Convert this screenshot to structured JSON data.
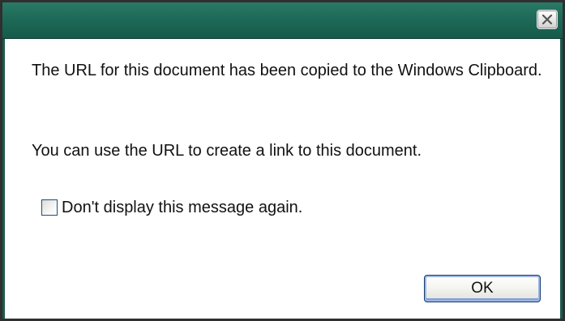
{
  "dialog": {
    "close_icon": "close-x-icon",
    "message_line": "The URL for this document has been copied to the Windows Clipboard.",
    "message_hint": "You can use the URL to create a link to this document.",
    "checkbox_label": "Don't display this message again.",
    "checkbox_checked": false,
    "ok_label": "OK"
  },
  "colors": {
    "titlebar": "#1f6b59",
    "frame": "#2f2f2f",
    "ok_focus": "#7f9fd8"
  }
}
